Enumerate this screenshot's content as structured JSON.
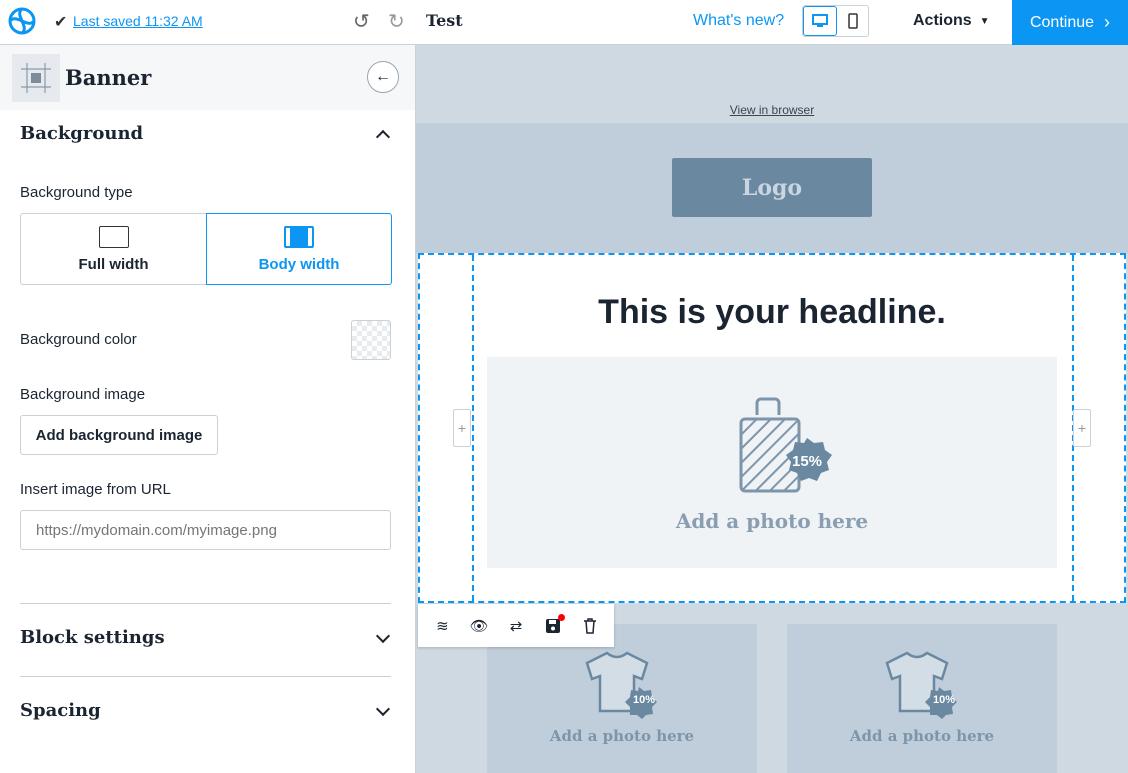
{
  "topbar": {
    "last_saved": "Last saved 11:32 AM",
    "title": "Test",
    "whats_new": "What's new?",
    "actions": "Actions",
    "continue": "Continue",
    "accent": "#0b96f3"
  },
  "panel": {
    "title": "Banner",
    "background": {
      "title": "Background",
      "type_label": "Background type",
      "options": [
        "Full width",
        "Body width"
      ],
      "selected": "Body width",
      "color_label": "Background color",
      "image_label": "Background image",
      "add_image": "Add background image",
      "url_label": "Insert image from URL",
      "url_placeholder": "https://mydomain.com/myimage.png",
      "url_value": ""
    },
    "block_settings": "Block settings",
    "spacing": "Spacing"
  },
  "canvas": {
    "view_in_browser": "View in browser",
    "logo": "Logo",
    "headline": "This is your headline.",
    "photo_text": "Add a photo here",
    "badge": "15%",
    "products": [
      {
        "text": "Add a photo here",
        "badge": "10%"
      },
      {
        "text": "Add a photo here",
        "badge": "10%"
      }
    ]
  }
}
